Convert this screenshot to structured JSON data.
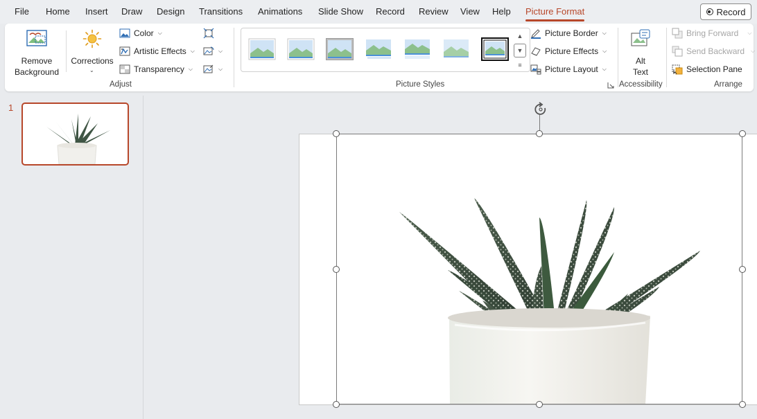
{
  "tabs": [
    "File",
    "Home",
    "Insert",
    "Draw",
    "Design",
    "Transitions",
    "Animations",
    "Slide Show",
    "Record",
    "Review",
    "View",
    "Help",
    "Picture Format"
  ],
  "record_button": "Record",
  "adjust": {
    "remove_background": [
      "Remove",
      "Background"
    ],
    "corrections": "Corrections",
    "color": "Color",
    "artistic_effects": "Artistic Effects",
    "transparency": "Transparency",
    "group_label": "Adjust"
  },
  "picture_styles": {
    "group_label": "Picture Styles",
    "picture_border": "Picture Border",
    "picture_effects": "Picture Effects",
    "picture_layout": "Picture Layout"
  },
  "accessibility": {
    "alt_text": [
      "Alt",
      "Text"
    ],
    "group_label": "Accessibility"
  },
  "arrange": {
    "bring_forward": "Bring Forward",
    "send_backward": "Send Backward",
    "selection_pane": "Selection Pane",
    "group_label": "Arrange"
  },
  "slides": {
    "number": "1"
  },
  "colors": {
    "accent": "#b7472a"
  }
}
